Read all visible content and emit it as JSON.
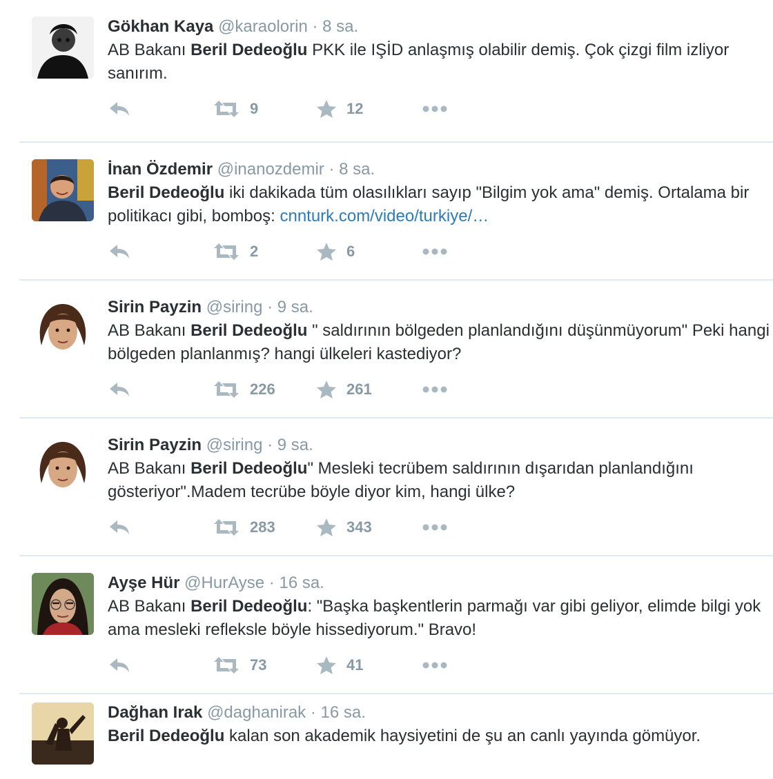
{
  "tweets": [
    {
      "fullname": "Gökhan Kaya",
      "username": "@karaolorin",
      "time": "8 sa.",
      "text_parts": [
        "AB Bakanı ",
        "Beril Dedeoğlu",
        " PKK ile IŞİD anlaşmış olabilir demiş. Çok çizgi film izliyor sanırım."
      ],
      "retweets": "9",
      "favorites": "12"
    },
    {
      "fullname": "İnan Özdemir",
      "username": "@inanozdemir",
      "time": "8 sa.",
      "text_parts": [
        "",
        "Beril Dedeoğlu",
        " iki dakikada tüm olasılıkları sayıp \"Bilgim yok ama\" demiş. Ortalama bir politikacı gibi, bomboş: "
      ],
      "link": "cnnturk.com/video/turkiye/…",
      "retweets": "2",
      "favorites": "6"
    },
    {
      "fullname": "Sirin Payzin",
      "username": "@siring",
      "time": "9 sa.",
      "text_parts": [
        "AB Bakanı ",
        "Beril Dedeoğlu",
        " \" saldırının bölgeden planlandığını düşünmüyorum\" Peki hangi bölgeden planlanmış? hangi ülkeleri kastediyor?"
      ],
      "retweets": "226",
      "favorites": "261"
    },
    {
      "fullname": "Sirin Payzin",
      "username": "@siring",
      "time": "9 sa.",
      "text_parts": [
        "AB Bakanı ",
        "Beril Dedeoğlu",
        "\" Mesleki tecrübem saldırının dışarıdan planlandığını gösteriyor\".Madem tecrübe böyle diyor kim, hangi ülke?"
      ],
      "retweets": "283",
      "favorites": "343"
    },
    {
      "fullname": "Ayşe Hür",
      "username": "@HurAyse",
      "time": "16 sa.",
      "text_parts": [
        "AB Bakanı ",
        "Beril Dedeoğlu",
        ": \"Başka başkentlerin parmağı var gibi geliyor, elimde bilgi yok ama mesleki refleksle böyle hissediyorum.\" Bravo!"
      ],
      "retweets": "73",
      "favorites": "41"
    },
    {
      "fullname": "Dağhan Irak",
      "username": "@daghanirak",
      "time": "16 sa.",
      "text_parts": [
        "",
        "Beril Dedeoğlu",
        " kalan son akademik haysiyetini de şu an canlı yayında gömüyor."
      ]
    }
  ],
  "separator": "·",
  "colors": {
    "name": "#292f33",
    "meta": "#8899a6",
    "link": "#2b7bb9",
    "icon": "#aab8c2",
    "divider": "#e1e8ed"
  },
  "icons": {
    "reply": "reply-icon",
    "retweet": "retweet-icon",
    "favorite": "star-icon",
    "more": "more-dots-icon"
  }
}
